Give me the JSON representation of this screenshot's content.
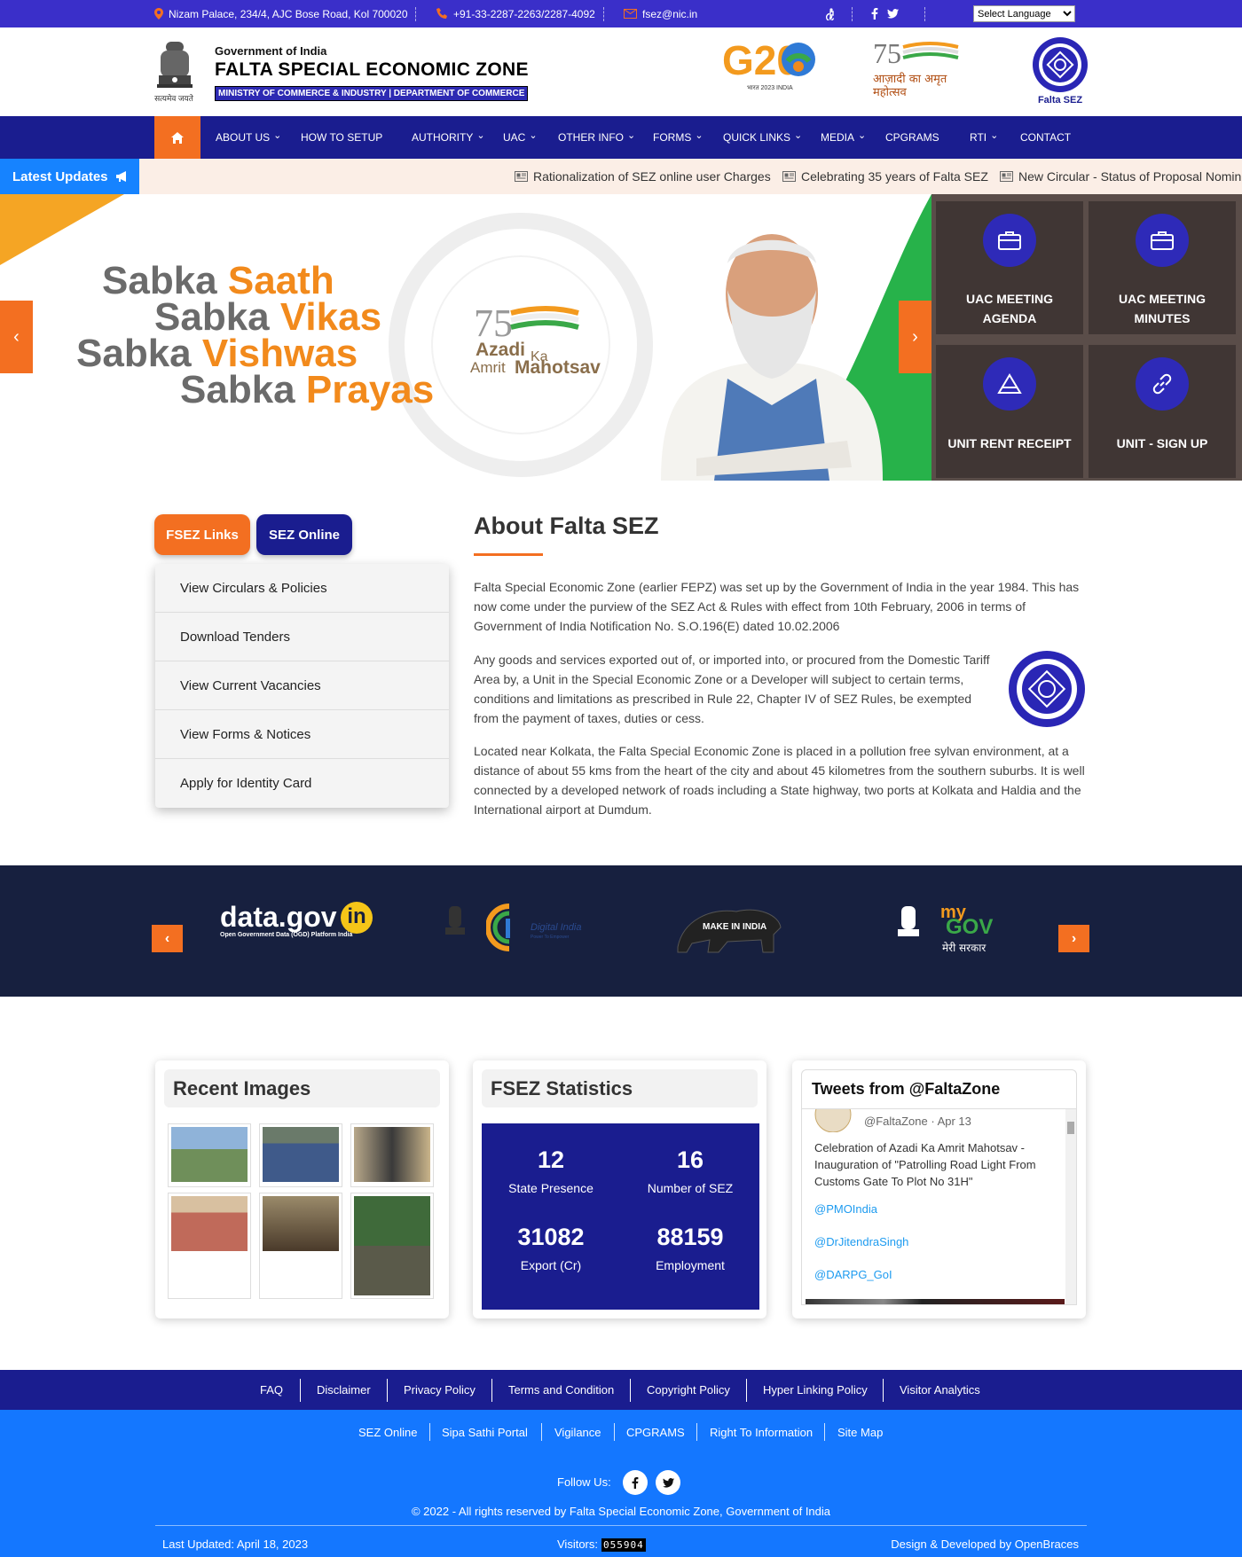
{
  "topbar": {
    "address": "Nizam Palace, 234/4, AJC Bose Road, Kol 700020",
    "phone": "+91-33-2287-2263/2287-4092",
    "email": "fsez@nic.in",
    "language_select": "Select Language"
  },
  "header": {
    "gov": "Government of India",
    "title": "FALTA SPECIAL ECONOMIC ZONE",
    "ministry": "MINISTRY OF COMMERCE & INDUSTRY | DEPARTMENT OF COMMERCE",
    "emblem_caption": "सत्यमेव जयते",
    "g20_text": "G20",
    "g20_sub": "भारत 2023 INDIA",
    "azadi_text": "आज़ादी का अमृत महोत्सव",
    "fsez_logo_caption": "Falta SEZ"
  },
  "nav": {
    "items": [
      {
        "label": "ABOUT US",
        "dropdown": true
      },
      {
        "label": "HOW TO SETUP",
        "dropdown": false
      },
      {
        "label": "AUTHORITY",
        "dropdown": true
      },
      {
        "label": "UAC",
        "dropdown": true
      },
      {
        "label": "OTHER INFO",
        "dropdown": true
      },
      {
        "label": "FORMS",
        "dropdown": true
      },
      {
        "label": "QUICK LINKS",
        "dropdown": true
      },
      {
        "label": "MEDIA",
        "dropdown": true
      },
      {
        "label": "CPGRAMS",
        "dropdown": false
      },
      {
        "label": "RTI",
        "dropdown": true
      },
      {
        "label": "CONTACT",
        "dropdown": false
      }
    ]
  },
  "ticker": {
    "label": "Latest Updates",
    "items": [
      "Rationalization of SEZ online user Charges",
      "Celebrating 35 years of Falta SEZ",
      "New Circular - Status of Proposal Nomin"
    ]
  },
  "hero": {
    "slogan": [
      {
        "a": "Sabka ",
        "b": "Saath"
      },
      {
        "a": "Sabka ",
        "b": "Vikas"
      },
      {
        "a": "Sabka ",
        "b": "Vishwas"
      },
      {
        "a": "Sabka ",
        "b": "Prayas"
      }
    ],
    "azadi_badge": [
      "Azadi",
      "Ka",
      "Amrit",
      "Mahotsav"
    ],
    "tiles": [
      {
        "label1": "UAC MEETING",
        "label2": "AGENDA",
        "icon": "briefcase-icon"
      },
      {
        "label1": "UAC MEETING",
        "label2": "MINUTES",
        "icon": "briefcase-icon"
      },
      {
        "label1": "UNIT RENT RECEIPT",
        "label2": "",
        "icon": "triangle-icon"
      },
      {
        "label1": "UNIT - SIGN UP",
        "label2": "",
        "icon": "link-icon"
      }
    ]
  },
  "links_panel": {
    "tabs": [
      "FSEZ Links",
      "SEZ Online"
    ],
    "items": [
      "View Circulars & Policies",
      "Download Tenders",
      "View Current Vacancies",
      "View Forms & Notices",
      "Apply for Identity Card"
    ]
  },
  "about": {
    "title": "About Falta SEZ",
    "p1": "Falta Special Economic Zone (earlier FEPZ) was set up by the Government of India in the year 1984. This has now come under the purview of the SEZ Act & Rules with effect from 10th February, 2006 in terms of Government of India Notification No. S.O.196(E) dated 10.02.2006",
    "p2": "Any goods and services exported out of, or imported into, or procured from the Domestic Tariff Area by, a Unit in the Special Economic Zone or a Developer will subject to certain terms, conditions and limitations as prescribed in Rule 22, Chapter IV of SEZ Rules, be exempted from the payment of taxes, duties or cess.",
    "p3": "Located near Kolkata, the Falta Special Economic Zone is placed in a pollution free sylvan environment, at a distance of about 55 kms from the heart of the city and about 45 kilometres from the southern suburbs. It is well connected by a developed network of roads including a State highway, two ports at Kolkata and Haldia and the International airport at Dumdum."
  },
  "partners": {
    "datagov": "data.gov",
    "datagov_in": "in",
    "datagov_sub": "Open Government Data (OGD) Platform India",
    "digital_india": "Digital India",
    "digital_india_sub": "Power To Empower",
    "make_in_india": "MAKE IN INDIA",
    "mygov_my": "my",
    "mygov_gov": "GOV",
    "mygov_hindi": "मेरी सरकार"
  },
  "recent_images": {
    "title": "Recent Images"
  },
  "statistics": {
    "title": "FSEZ Statistics",
    "items": [
      {
        "value": "12",
        "label": "State Presence"
      },
      {
        "value": "16",
        "label": "Number of SEZ"
      },
      {
        "value": "31082",
        "label": "Export (Cr)"
      },
      {
        "value": "88159",
        "label": "Employment"
      }
    ]
  },
  "tweets": {
    "title": "Tweets from @FaltaZone",
    "meta": "@FaltaZone · Apr 13",
    "text": "Celebration of Azadi Ka  Amrit Mahotsav - Inauguration of \"Patrolling Road Light From Customs Gate To Plot No 31H\"",
    "mentions": [
      "@PMOIndia",
      "@DrJitendraSingh",
      "@DARPG_GoI"
    ]
  },
  "footer": {
    "row1": [
      "FAQ",
      "Disclaimer",
      "Privacy Policy",
      "Terms and Condition",
      "Copyright Policy",
      "Hyper Linking Policy",
      "Visitor Analytics"
    ],
    "row2": [
      "SEZ Online",
      "Sipa Sathi Portal",
      "Vigilance",
      "CPGRAMS",
      "Right To Information",
      "Site Map"
    ],
    "follow": "Follow Us:",
    "copyright": "© 2022 - All rights reserved by Falta Special Economic Zone, Government of India",
    "updated": "Last Updated: April 18, 2023",
    "visitors_label": "Visitors:",
    "visitors_count": "055904",
    "credit": "Design & Developed by OpenBraces"
  },
  "colors": {
    "topbar": "#3a2fc9",
    "nav": "#1a1d8f",
    "accent_orange": "#f36f21",
    "footer_blue": "#1477ff"
  }
}
